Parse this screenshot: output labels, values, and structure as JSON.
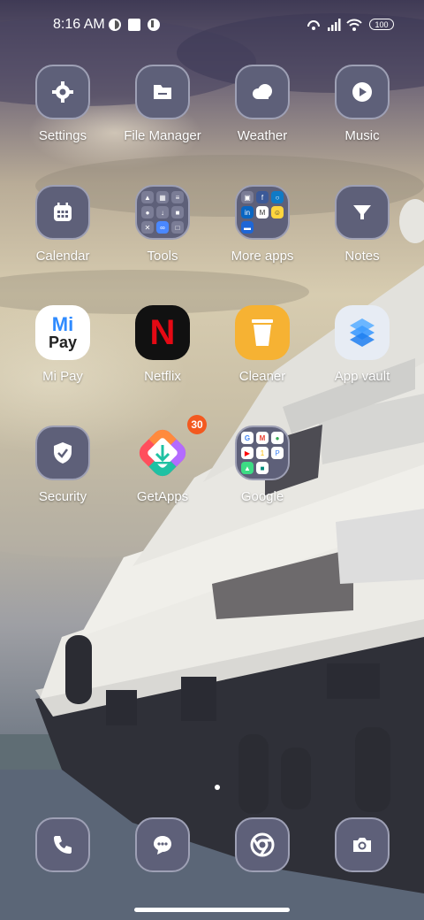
{
  "status_bar": {
    "time": "8:16 AM",
    "battery": "100",
    "left_icons": [
      "notification-app-icon",
      "square-notification-icon",
      "notification-app-icon-2"
    ],
    "right_icons": [
      "hotspot-icon",
      "signal-icon",
      "wifi-icon",
      "battery-icon"
    ]
  },
  "apps": {
    "settings": "Settings",
    "file_manager": "File Manager",
    "weather": "Weather",
    "music": "Music",
    "calendar": "Calendar",
    "tools": "Tools",
    "more_apps": "More apps",
    "notes": "Notes",
    "mi_pay": "Mi Pay",
    "netflix": "Netflix",
    "cleaner": "Cleaner",
    "app_vault": "App vault",
    "security": "Security",
    "getapps": "GetApps",
    "google": "Google"
  },
  "icon_text": {
    "mi_pay_top": "Mi",
    "mi_pay_bottom": "Pay",
    "netflix_letter": "N"
  },
  "badges": {
    "getapps": "30"
  },
  "dock": [
    "phone-icon",
    "messages-icon",
    "chrome-icon",
    "camera-icon"
  ],
  "colors": {
    "tile": "#5e6079",
    "tile_border": "#9ea0b5",
    "badge": "#f3591f"
  }
}
